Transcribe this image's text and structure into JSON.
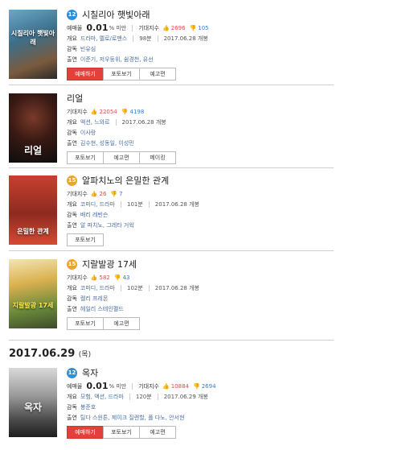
{
  "labels": {
    "reservation_rate": "예매율",
    "expectation": "기대지수",
    "overview": "개요",
    "director": "감독",
    "cast": "출연"
  },
  "movies": [
    {
      "age": "12",
      "title": "시칠리아 햇빛아래",
      "rate_value": "0.01",
      "rate_suffix": "% 미만",
      "likes": "2696",
      "dislikes": "105",
      "genre": "드라마, 멜로/로맨스",
      "runtime": "98분",
      "release": "2017.06.28 개봉",
      "director": "빈유심",
      "cast": "이준기, 저우둥위, 쉼경천, 유선",
      "poster_text": "시칠리아 햇빛아래",
      "buttons": [
        "예매하기",
        "포토보기",
        "예고편"
      ]
    },
    {
      "age": "",
      "title": "리얼",
      "likes": "22054",
      "dislikes": "4198",
      "genre": "액션, 느와르",
      "release": "2017.06.28 개봉",
      "director": "이사랑",
      "cast": "김수현, 성동일, 이성민",
      "poster_text": "리얼",
      "buttons": [
        "포토보기",
        "예고편",
        "메이킹"
      ]
    },
    {
      "age": "15",
      "title": "알파치노의 은밀한 관계",
      "likes": "26",
      "dislikes": "7",
      "genre": "코미디, 드라마",
      "runtime": "101분",
      "release": "2017.06.28 개봉",
      "director": "배리 레빈슨",
      "cast": "알 파치노, 그레타 거윅",
      "poster_text": "은밀한 관계",
      "buttons": [
        "포토보기"
      ]
    },
    {
      "age": "15",
      "title": "지랄발광 17세",
      "likes": "582",
      "dislikes": "43",
      "genre": "코미디, 드라마",
      "runtime": "102분",
      "release": "2017.06.28 개봉",
      "director": "켈리 프레몬",
      "cast": "헤일리 스테인펠드",
      "poster_text": "지랄발광 17세",
      "buttons": [
        "포토보기",
        "예고편"
      ]
    },
    {
      "age": "12",
      "title": "옥자",
      "rate_value": "0.01",
      "rate_suffix": "% 미만",
      "likes": "10884",
      "dislikes": "2694",
      "genre": "모험, 액션, 드라마",
      "runtime": "120분",
      "release": "2017.06.29 개봉",
      "director": "봉준호",
      "cast": "틸다 스윈튼, 제이크 질렌할, 폴 다노, 안서현",
      "poster_text": "옥자",
      "buttons": [
        "예매하기",
        "포토보기",
        "예고편"
      ]
    }
  ],
  "date_header": {
    "date": "2017.06.29",
    "day": "(목)"
  },
  "colors": {
    "reserve_button": "#e2413b",
    "age12": "#2f8fd8",
    "age15": "#e9a533",
    "like": "#e04d4d",
    "dislike": "#3a7bd5"
  }
}
